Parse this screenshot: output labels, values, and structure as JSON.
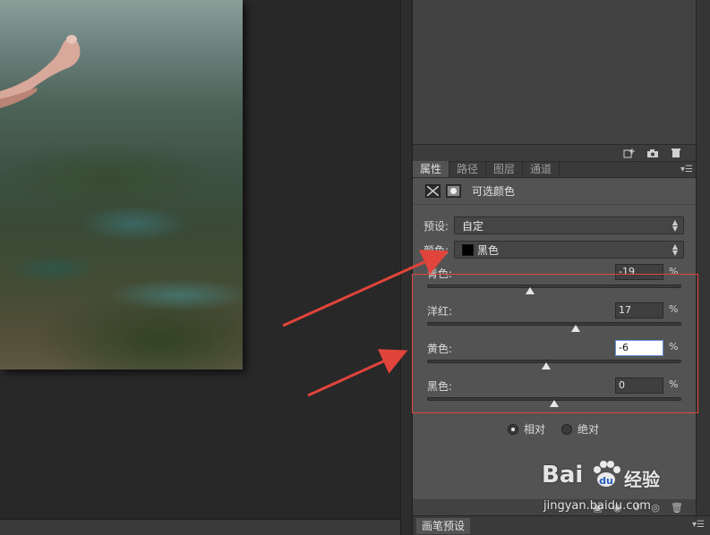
{
  "props_panel": {
    "tabs": [
      "属性",
      "路径",
      "图层",
      "通道"
    ],
    "title": "可选颜色"
  },
  "preset": {
    "label": "预设:",
    "value": "自定"
  },
  "colors": {
    "label": "颜色:",
    "value": "黑色",
    "swatch": "#000000"
  },
  "sliders": [
    {
      "label": "青色:",
      "value": "-19",
      "level": -19
    },
    {
      "label": "洋红:",
      "value": "17",
      "level": 17
    },
    {
      "label": "黄色:",
      "value": "-6",
      "level": -6
    },
    {
      "label": "黑色:",
      "value": "0",
      "level": 0
    }
  ],
  "percent_sign": "%",
  "method": {
    "relative": "相对",
    "absolute": "绝对",
    "selected": "relative"
  },
  "bottom_tab": "画笔预设",
  "watermark": {
    "brand": "Bai",
    "suffix": "经验",
    "url": "jingyan.baidu.com"
  },
  "colors_theme": {
    "panel": "#535353",
    "annotation": "#e0443a"
  }
}
